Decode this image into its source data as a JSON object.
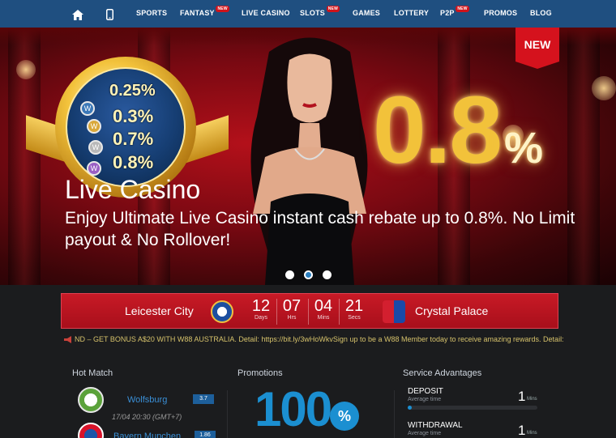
{
  "nav": {
    "items": [
      {
        "label": "SPORTS",
        "new": false
      },
      {
        "label": "FANTASY",
        "new": true
      },
      {
        "label": "LIVE CASINO",
        "new": false
      },
      {
        "label": "SLOTS",
        "new": true
      },
      {
        "label": "GAMES",
        "new": false
      },
      {
        "label": "LOTTERY",
        "new": false
      },
      {
        "label": "P2P",
        "new": true
      },
      {
        "label": "PROMOS",
        "new": false
      },
      {
        "label": "BLOG",
        "new": false
      }
    ],
    "new_badge": "NEW"
  },
  "hero": {
    "new_badge": "NEW",
    "medal_rates": [
      "0.25%",
      "0.3%",
      "0.7%",
      "0.8%"
    ],
    "big_rate": "0.8",
    "big_rate_pct": "%",
    "title": "Live Casino",
    "description": "Enjoy Ultimate Live Casino instant cash rebate up to 0.8%. No Limit payout & No Rollover!",
    "slides": 3,
    "active_slide": 2
  },
  "match": {
    "home": "Leicester City",
    "away": "Crystal Palace",
    "countdown": [
      {
        "value": "12",
        "unit": "Days"
      },
      {
        "value": "07",
        "unit": "Hrs"
      },
      {
        "value": "04",
        "unit": "Mins"
      },
      {
        "value": "21",
        "unit": "Secs"
      }
    ]
  },
  "ticker": {
    "text": "ND – GET BONUS A$20 WITH W88 AUSTRALIA. Detail: https://bit.ly/3wHoWkvSign up to be a W88 Member today to receive amazing rewards. Detail:"
  },
  "hot_match": {
    "title": "Hot Match",
    "team1": "Wolfsburg",
    "odds1": "3.7",
    "time": "17/04 20:30 (GMT+7)",
    "team2": "Bayern Munchen",
    "odds2": "1.86"
  },
  "promotions": {
    "title": "Promotions",
    "number": "100",
    "pct": "%"
  },
  "service": {
    "title": "Service Advantages",
    "items": [
      {
        "label": "DEPOSIT",
        "sub": "Average time",
        "value": "1",
        "unit": "Mins",
        "fill": 0.02
      },
      {
        "label": "WITHDRAWAL",
        "sub": "Average time",
        "value": "1",
        "unit": "Mins",
        "fill": 0.02
      }
    ]
  },
  "colors": {
    "nav_bg": "#1f4f80",
    "accent_red": "#c81a26",
    "accent_blue": "#1b8fd1",
    "gold": "#f2c23a"
  }
}
